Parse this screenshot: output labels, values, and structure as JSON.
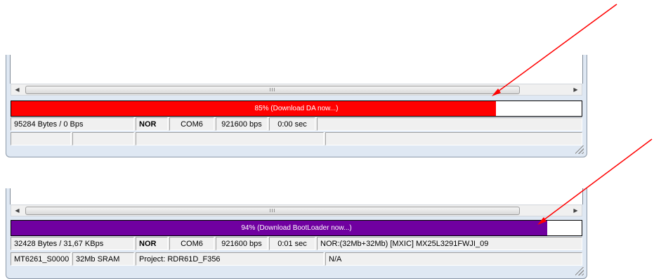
{
  "panel1": {
    "scroll_glyph": "III",
    "progress": {
      "percent": 0.85,
      "label": "85% (Download DA now...)",
      "color": "#ff0000"
    },
    "status_row1": [
      "95284 Bytes / 0 Bps",
      "NOR",
      "COM6",
      "921600 bps",
      "0:00 sec",
      ""
    ],
    "status_row2": [
      "",
      "",
      "",
      ""
    ]
  },
  "panel2": {
    "scroll_glyph": "III",
    "progress": {
      "percent": 0.94,
      "label": "94% (Download BootLoader now...)",
      "color": "#7000a0"
    },
    "status_row1": [
      "32428 Bytes / 31,67 KBps",
      "NOR",
      "COM6",
      "921600 bps",
      "0:01 sec",
      "NOR:(32Mb+32Mb) [MXIC] MX25L3291FWJI_09"
    ],
    "status_row2": [
      "MT6261_S0000",
      "32Mb SRAM",
      "Project: RDR61D_F356",
      "N/A"
    ]
  },
  "annotation_color": "#ff0000",
  "icons": {
    "scroll_left": "◀",
    "scroll_right": "▶"
  }
}
